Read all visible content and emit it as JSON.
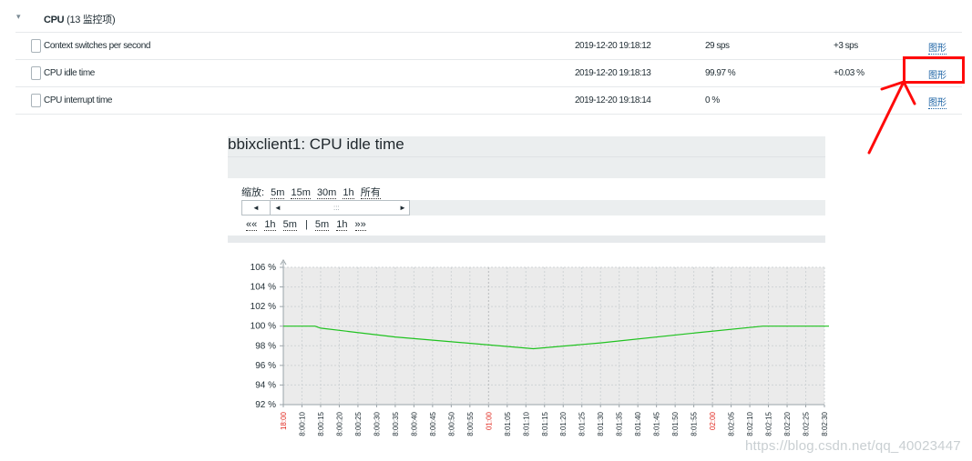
{
  "group": {
    "caret": "▾",
    "title": "CPU",
    "count": "(13 监控项)"
  },
  "items": [
    {
      "name": "Context switches per second",
      "time": "2019-12-20 19:18:12",
      "value": "29 sps",
      "change": "+3 sps",
      "graph": "图形"
    },
    {
      "name": "CPU idle time",
      "time": "2019-12-20 19:18:13",
      "value": "99.97 %",
      "change": "+0.03 %",
      "graph": "图形"
    },
    {
      "name": "CPU interrupt time",
      "time": "2019-12-20 19:18:14",
      "value": "0 %",
      "change": "",
      "graph": "图形"
    }
  ],
  "graph_panel": {
    "title": "bbixclient1: CPU idle time",
    "zoom_label": "缩放:",
    "zoom_options": [
      "5m",
      "15m",
      "30m",
      "1h",
      "所有"
    ],
    "scroller": {
      "left": "◄",
      "left2": "◄",
      "grip": ":::",
      "right": "►"
    },
    "nav": {
      "first": "««",
      "back_1h": "1h",
      "back_5m": "5m",
      "sep": "|",
      "fwd_5m": "5m",
      "fwd_1h": "1h",
      "last": "»»"
    }
  },
  "chart_data": {
    "type": "line",
    "y_unit": "%",
    "ylim": [
      92,
      106
    ],
    "y_ticks": [
      "106 %",
      "104 %",
      "102 %",
      "100 %",
      "98 %",
      "96 %",
      "94 %",
      "92 %"
    ],
    "x_ticks": [
      "18:00",
      "8:00:10",
      "8:00:15",
      "8:00:20",
      "8:00:25",
      "8:00:30",
      "8:00:35",
      "8:00:40",
      "8:00:45",
      "8:00:50",
      "8:00:55",
      "01:00",
      "8:01:05",
      "8:01:10",
      "8:01:15",
      "8:01:20",
      "8:01:25",
      "8:01:30",
      "8:01:35",
      "8:01:40",
      "8:01:45",
      "8:01:50",
      "8:01:55",
      "02:00",
      "8:02:05",
      "8:02:10",
      "8:02:15",
      "8:02:20",
      "8:02:25",
      "8:02:30"
    ],
    "x_ticks_red": [
      0,
      11,
      23
    ],
    "grid": true,
    "series": [
      {
        "color": "#1fc21f",
        "points": [
          [
            0,
            100
          ],
          [
            1.7,
            100
          ],
          [
            2.0,
            99.8
          ],
          [
            6.0,
            98.9
          ],
          [
            13.4,
            97.7
          ],
          [
            17.0,
            98.3
          ],
          [
            22.0,
            99.3
          ],
          [
            25.7,
            100
          ],
          [
            29.4,
            100
          ]
        ]
      }
    ]
  },
  "annotation": {
    "box_color": "#ff0a0a"
  },
  "watermark": "https://blog.csdn.net/qq_40023447"
}
